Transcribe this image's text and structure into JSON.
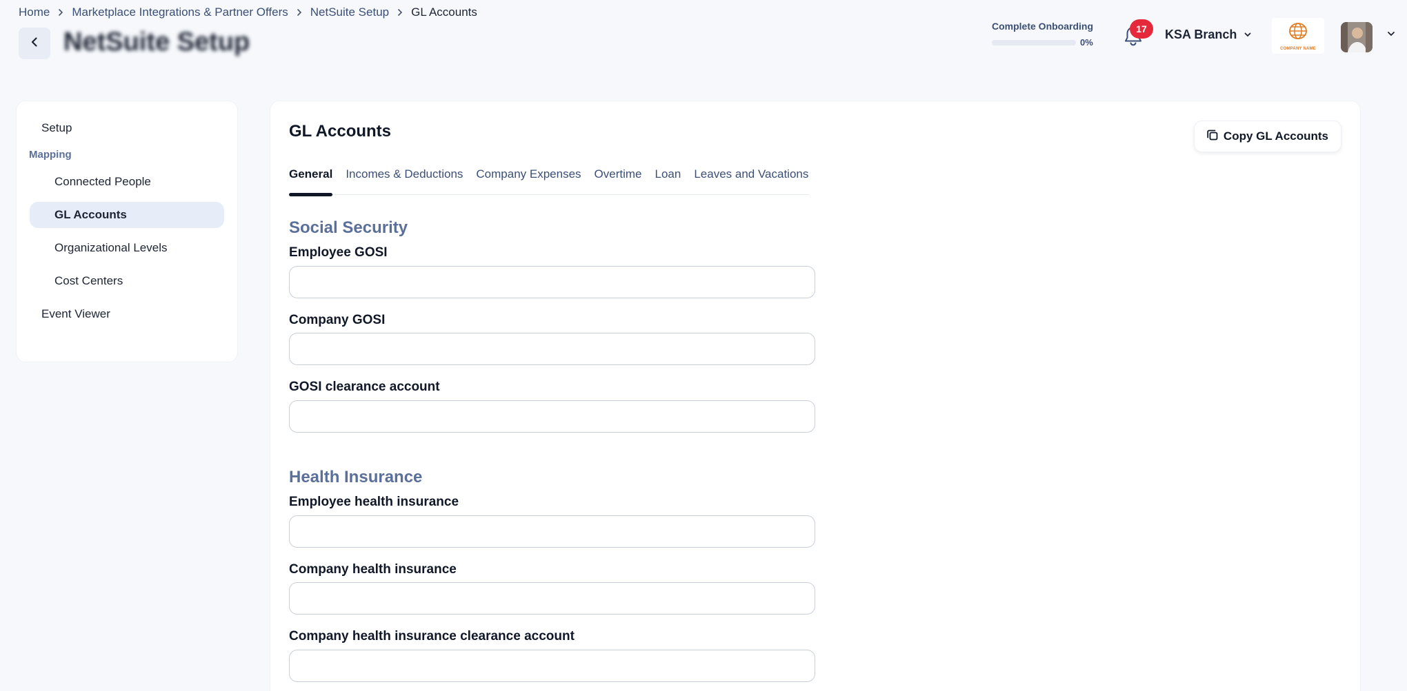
{
  "breadcrumb": {
    "items": [
      "Home",
      "Marketplace Integrations & Partner Offers",
      "NetSuite Setup",
      "GL Accounts"
    ]
  },
  "header": {
    "page_title": "NetSuite Setup",
    "onboarding_label": "Complete Onboarding",
    "onboarding_percent": "0%",
    "onboarding_progress": 0,
    "notification_count": "17",
    "branch": "KSA Branch",
    "company_logo_text": "COMPANY NAME"
  },
  "sidebar": {
    "setup": "Setup",
    "mapping_section": "Mapping",
    "sub_items": [
      "Connected People",
      "GL Accounts",
      "Organizational Levels",
      "Cost Centers"
    ],
    "active_item": "GL Accounts",
    "event_viewer": "Event Viewer"
  },
  "main": {
    "title": "GL Accounts",
    "copy_button": "Copy GL Accounts",
    "tabs": [
      "General",
      "Incomes & Deductions",
      "Company Expenses",
      "Overtime",
      "Loan",
      "Leaves and Vacations"
    ],
    "active_tab": "General",
    "sections": [
      {
        "title": "Social Security",
        "fields": [
          {
            "label": "Employee GOSI",
            "value": ""
          },
          {
            "label": "Company GOSI",
            "value": ""
          },
          {
            "label": "GOSI clearance account",
            "value": ""
          }
        ]
      },
      {
        "title": "Health Insurance",
        "fields": [
          {
            "label": "Employee health insurance",
            "value": ""
          },
          {
            "label": "Company health insurance",
            "value": ""
          },
          {
            "label": "Company health insurance clearance account",
            "value": ""
          }
        ]
      }
    ]
  },
  "colors": {
    "background": "#f6f8fc",
    "accent_text": "#3b4f75",
    "section_title": "#5a6f99",
    "badge": "#e5293b",
    "active_nav_bg": "#e6ecf8"
  }
}
